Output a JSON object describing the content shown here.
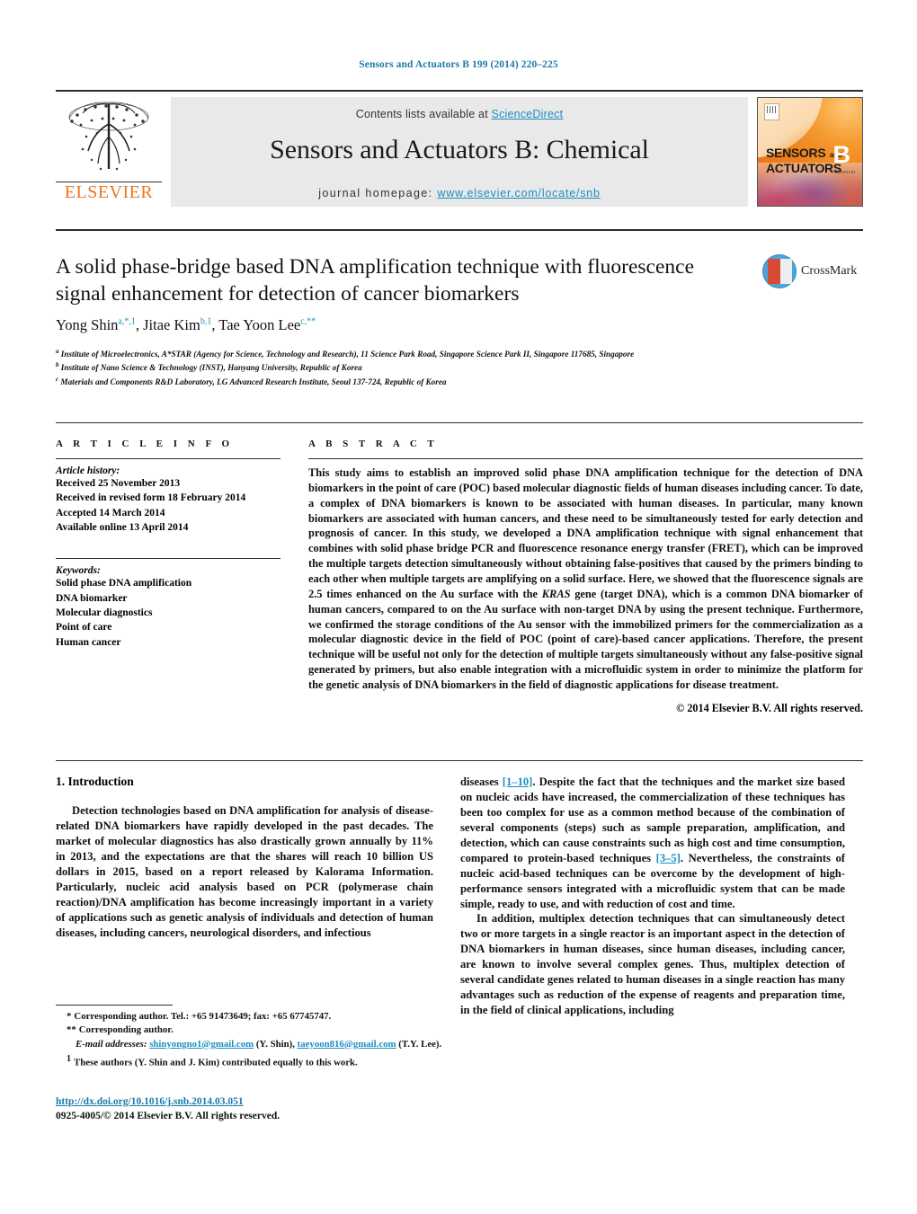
{
  "running_head": "Sensors and Actuators B 199 (2014) 220–225",
  "masthead": {
    "contents_prefix": "Contents lists available at ",
    "contents_link": "ScienceDirect",
    "journal_title": "Sensors and Actuators B: Chemical",
    "homepage_label": "journal homepage:",
    "homepage_url": "www.elsevier.com/locate/snb",
    "publisher_wordmark": "ELSEVIER",
    "cover": {
      "line1": "SENSORS",
      "and": "and",
      "line2": "ACTUATORS",
      "letter": "B",
      "sub": "Chemical"
    },
    "accent_link_color": "#1a8fc1",
    "band_color": "#e9e9e9",
    "elsevier_orange": "#e87722"
  },
  "article": {
    "title": "A solid phase-bridge based DNA amplification technique with fluorescence signal enhancement for detection of cancer biomarkers",
    "crossmark_label": "CrossMark",
    "authors": [
      {
        "name": "Yong Shin",
        "marks": "a,*,1"
      },
      {
        "name": "Jitae Kim",
        "marks": "b,1"
      },
      {
        "name": "Tae Yoon Lee",
        "marks": "c,**"
      }
    ],
    "affiliations": [
      {
        "mark": "a",
        "text": "Institute of Microelectronics, A*STAR (Agency for Science, Technology and Research), 11 Science Park Road, Singapore Science Park II, Singapore 117685, Singapore"
      },
      {
        "mark": "b",
        "text": "Institute of Nano Science & Technology (INST), Hanyang University, Republic of Korea"
      },
      {
        "mark": "c",
        "text": "Materials and Components R&D Laboratory, LG Advanced Research Institute, Seoul 137-724, Republic of Korea"
      }
    ]
  },
  "article_info": {
    "heading": "A R T I C L E   I N F O",
    "history_label": "Article history:",
    "history": [
      "Received 25 November 2013",
      "Received in revised form 18 February 2014",
      "Accepted 14 March 2014",
      "Available online 13 April 2014"
    ],
    "keywords_label": "Keywords:",
    "keywords": [
      "Solid phase DNA amplification",
      "DNA biomarker",
      "Molecular diagnostics",
      "Point of care",
      "Human cancer"
    ]
  },
  "abstract": {
    "heading": "A B S T R A C T",
    "part1": "This study aims to establish an improved solid phase DNA amplification technique for the detection of DNA biomarkers in the point of care (POC) based molecular diagnostic fields of human diseases including cancer. To date, a complex of DNA biomarkers is known to be associated with human diseases. In particular, many known biomarkers are associated with human cancers, and these need to be simultaneously tested for early detection and prognosis of cancer. In this study, we developed a DNA amplification technique with signal enhancement that combines with solid phase bridge PCR and fluorescence resonance energy transfer (FRET), which can be improved the multiple targets detection simultaneously without obtaining false-positives that caused by the primers binding to each other when multiple targets are amplifying on a solid surface. Here, we showed that the fluorescence signals are 2.5 times enhanced on the Au surface with the ",
    "italic_gene": "KRAS",
    "part2": " gene (target DNA), which is a common DNA biomarker of human cancers, compared to on the Au surface with non-target DNA by using the present technique. Furthermore, we confirmed the storage conditions of the Au sensor with the immobilized primers for the commercialization as a molecular diagnostic device in the field of POC (point of care)-based cancer applications. Therefore, the present technique will be useful not only for the detection of multiple targets simultaneously without any false-positive signal generated by primers, but also enable integration with a microfluidic system in order to minimize the platform for the genetic analysis of DNA biomarkers in the field of diagnostic applications for disease treatment.",
    "copyright": "© 2014 Elsevier B.V. All rights reserved."
  },
  "introduction": {
    "heading": "1.  Introduction",
    "left_paragraph": "Detection technologies based on DNA amplification for analysis of disease-related DNA biomarkers have rapidly developed in the past decades. The market of molecular diagnostics has also drastically grown annually by 11% in 2013, and the expectations are that the shares will reach 10 billion US dollars in 2015, based on a report released by Kalorama Information. Particularly, nucleic acid analysis based on PCR (polymerase chain reaction)/DNA amplification has become increasingly important in a variety of applications such as genetic analysis of individuals and detection of human diseases, including cancers, neurological disorders, and infectious",
    "right_cont_a": "diseases ",
    "right_ref_1": "[1–10]",
    "right_cont_b": ". Despite the fact that the techniques and the market size based on nucleic acids have increased, the commercialization of these techniques has been too complex for use as a common method because of the combination of several components (steps) such as sample preparation, amplification, and detection, which can cause constraints such as high cost and time consumption, compared to protein-based techniques ",
    "right_ref_2": "[3–5]",
    "right_cont_c": ". Nevertheless, the constraints of nucleic acid-based techniques can be overcome by the development of high-performance sensors integrated with a microfluidic system that can be made simple, ready to use, and with reduction of cost and time.",
    "right_paragraph_2": "In addition, multiplex detection techniques that can simultaneously detect two or more targets in a single reactor is an important aspect in the detection of DNA biomarkers in human diseases, since human diseases, including cancer, are known to involve several complex genes. Thus, multiplex detection of several candidate genes related to human diseases in a single reaction has many advantages such as reduction of the expense of reagents and preparation time, in the field of clinical applications, including"
  },
  "footnotes": {
    "corresponding_1_mark": "*",
    "corresponding_1": "Corresponding author. Tel.: +65 91473649; fax: +65 67745747.",
    "corresponding_2_mark": "**",
    "corresponding_2": "Corresponding author.",
    "email_label": "E-mail addresses:",
    "email_1": "shinyongno1@gmail.com",
    "email_1_author": "(Y. Shin),",
    "email_2": "taeyoon816@gmail.com",
    "email_2_author": "(T.Y. Lee).",
    "equal_mark": "1",
    "equal_contrib": "These authors (Y. Shin and J. Kim) contributed equally to this work.",
    "doi": "http://dx.doi.org/10.1016/j.snb.2014.03.051",
    "issn": "0925-4005/© 2014 Elsevier B.V. All rights reserved."
  }
}
